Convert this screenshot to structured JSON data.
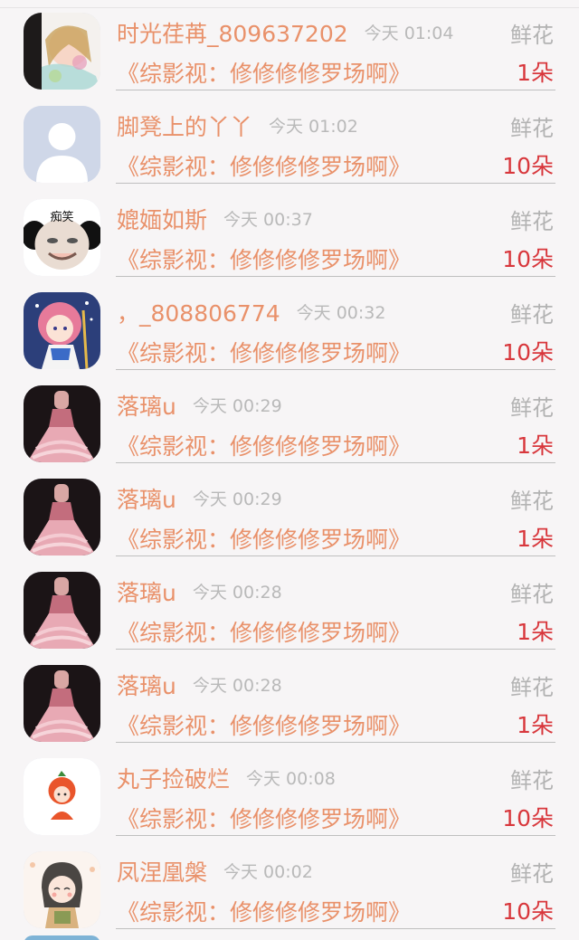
{
  "gift_type_label": "鲜花",
  "rows": [
    {
      "name": "时光荏苒_809637202",
      "time": "今天 01:04",
      "book": "《综影视：修修修修罗场啊》",
      "amount": "1朵",
      "avatar": "avatar-anime-girl-icon"
    },
    {
      "name": "脚凳上的丫丫",
      "time": "今天 01:02",
      "book": "《综影视：修修修修罗场啊》",
      "amount": "10朵",
      "avatar": "avatar-default-person-icon"
    },
    {
      "name": "媲媔如斯",
      "time": "今天 00:37",
      "book": "《综影视：修修修修罗场啊》",
      "amount": "10朵",
      "avatar": "avatar-meme-face-icon",
      "avatar_text": "痴笑"
    },
    {
      "name": "，_808806774",
      "time": "今天 00:32",
      "book": "《综影视：修修修修罗场啊》",
      "amount": "10朵",
      "avatar": "avatar-pink-hair-girl-icon"
    },
    {
      "name": "落璃u",
      "time": "今天 00:29",
      "book": "《综影视：修修修修罗场啊》",
      "amount": "1朵",
      "avatar": "avatar-pink-dress-icon"
    },
    {
      "name": "落璃u",
      "time": "今天 00:29",
      "book": "《综影视：修修修修罗场啊》",
      "amount": "1朵",
      "avatar": "avatar-pink-dress-icon"
    },
    {
      "name": "落璃u",
      "time": "今天 00:28",
      "book": "《综影视：修修修修罗场啊》",
      "amount": "1朵",
      "avatar": "avatar-pink-dress-icon"
    },
    {
      "name": "落璃u",
      "time": "今天 00:28",
      "book": "《综影视：修修修修罗场啊》",
      "amount": "1朵",
      "avatar": "avatar-pink-dress-icon"
    },
    {
      "name": "丸子捡破烂",
      "time": "今天 00:08",
      "book": "《综影视：修修修修罗场啊》",
      "amount": "10朵",
      "avatar": "avatar-orange-kid-icon"
    },
    {
      "name": "凤涅凰槃",
      "time": "今天 00:02",
      "book": "《综影视：修修修修罗场啊》",
      "amount": "10朵",
      "avatar": "avatar-braid-girl-icon"
    }
  ],
  "colors": {
    "name": "#e9916a",
    "time": "#b9b9b9",
    "amount": "#d8373c",
    "gift_type": "#b3b3b3",
    "background": "#f7f5f6"
  }
}
